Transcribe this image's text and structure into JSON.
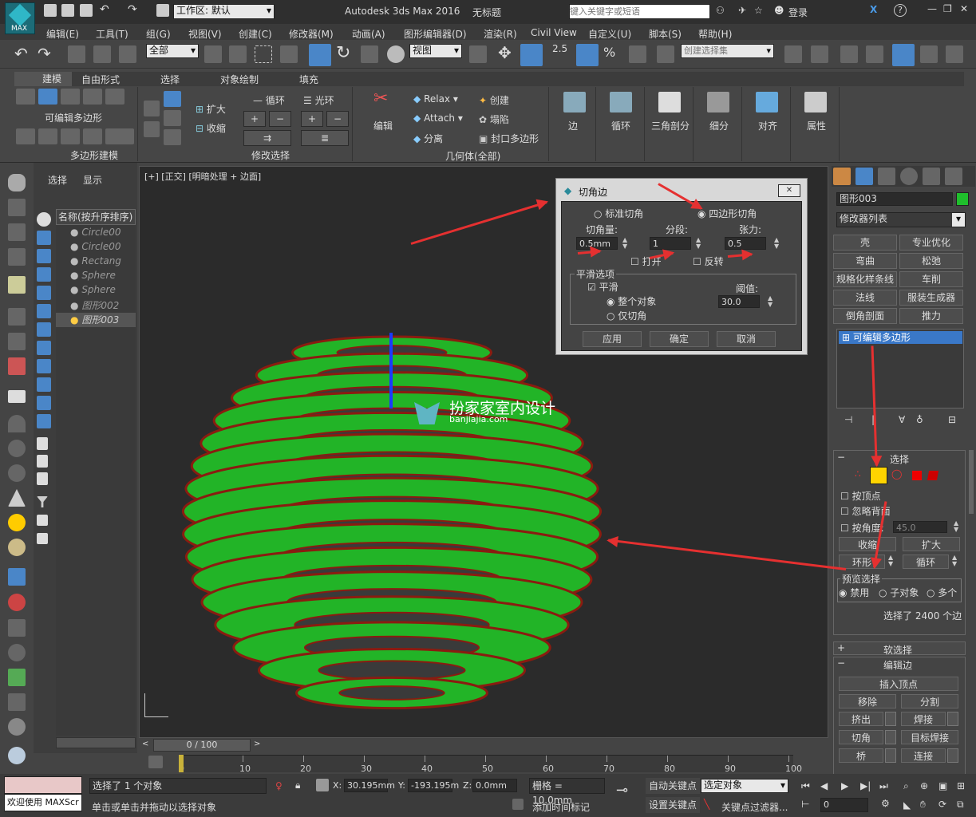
{
  "app": {
    "title": "Autodesk 3ds Max 2016",
    "doc": "无标题",
    "workspace_label": "工作区: 默认",
    "search_placeholder": "键入关键字或短语",
    "login": "登录",
    "max_label": "MAX"
  },
  "menu": [
    "编辑(E)",
    "工具(T)",
    "组(G)",
    "视图(V)",
    "创建(C)",
    "修改器(M)",
    "动画(A)",
    "图形编辑器(D)",
    "渲染(R)",
    "Civil View",
    "自定义(U)",
    "脚本(S)",
    "帮助(H)"
  ],
  "toolbar": {
    "filter": "全部",
    "ref_coord": "视图",
    "selset_placeholder": "创建选择集",
    "snap_val": "2.5"
  },
  "ribbon": {
    "tabs": [
      "建模",
      "自由形式",
      "选择",
      "对象绘制",
      "填充"
    ],
    "poly_title": "可编辑多边形",
    "poly_footer": "多边形建模",
    "expand": "扩大",
    "shrink": "收缩",
    "loop": "循环",
    "ring": "光环",
    "sel_footer": "修改选择",
    "edit": "编辑",
    "relax": "Relax",
    "attach": "Attach",
    "detach": "分离",
    "create": "创建",
    "collapse": "塌陷",
    "cap": "封口多边形",
    "geo_footer": "几何体(全部)",
    "edge": "边",
    "loop2": "循环",
    "tri": "三角剖分",
    "subdiv": "细分",
    "align": "对齐",
    "props": "属性"
  },
  "scene": {
    "tabs": [
      "选择",
      "显示"
    ],
    "header": "名称(按升序排序)",
    "items": [
      "Circle00",
      "Circle00",
      "Rectang",
      "Sphere",
      "Sphere",
      "图形002",
      "图形003"
    ]
  },
  "viewport": {
    "label": "[+] [正交] [明暗处理 + 边面]",
    "watermark_cn": "扮家家室内设计",
    "watermark_url": "banjiajia.com"
  },
  "dialog": {
    "title": "切角边",
    "opt_standard": "标准切角",
    "opt_quad": "四边形切角",
    "amount_label": "切角量:",
    "segments_label": "分段:",
    "tension_label": "张力:",
    "amount": "0.5mm",
    "segments": "1",
    "tension": "0.5",
    "open": "打开",
    "invert": "反转",
    "smooth_group": "平滑选项",
    "smooth": "平滑",
    "whole": "整个对象",
    "chamfers_only": "仅切角",
    "threshold_label": "阈值:",
    "threshold": "30.0",
    "apply": "应用",
    "ok": "确定",
    "cancel": "取消"
  },
  "cmd": {
    "object_name": "图形003",
    "modlist": "修改器列表",
    "mods": [
      "壳",
      "专业优化",
      "弯曲",
      "松弛",
      "规格化样条线",
      "车削",
      "法线",
      "服装生成器",
      "倒角剖面",
      "推力"
    ],
    "stack_item": "可编辑多边形",
    "sel_title": "选择",
    "by_vertex": "按顶点",
    "ignore_back": "忽略背面",
    "by_angle": "按角度:",
    "angle_val": "45.0",
    "shrink": "收缩",
    "grow": "扩大",
    "ring": "环形",
    "loop": "循环",
    "preview": "预览选择",
    "disable": "禁用",
    "subobj": "子对象",
    "multi": "多个",
    "selected_info": "选择了 2400 个边",
    "soft": "软选择",
    "edit_edges": "编辑边",
    "insert_vertex": "插入顶点",
    "remove": "移除",
    "split": "分割",
    "extrude": "挤出",
    "weld": "焊接",
    "chamfer": "切角",
    "target_weld": "目标焊接",
    "bridge": "桥",
    "connect": "连接"
  },
  "timeline": {
    "pos": "0 / 100",
    "ticks": [
      "0",
      "10",
      "20",
      "30",
      "40",
      "50",
      "60",
      "70",
      "80",
      "90",
      "100"
    ]
  },
  "status": {
    "welcome": "欢迎使用 MAXScr",
    "sel_count": "选择了 1 个对象",
    "hint": "单击或单击并拖动以选择对象",
    "x_label": "X:",
    "x": "30.195mm",
    "y_label": "Y:",
    "y": "-193.195m",
    "z_label": "Z:",
    "z": "0.0mm",
    "grid": "栅格 = 10.0mm",
    "add_tag": "添加时间标记",
    "auto_key": "自动关键点",
    "sel_obj": "选定对象",
    "set_key": "设置关键点",
    "key_filter": "关键点过滤器...",
    "frame": "0"
  }
}
